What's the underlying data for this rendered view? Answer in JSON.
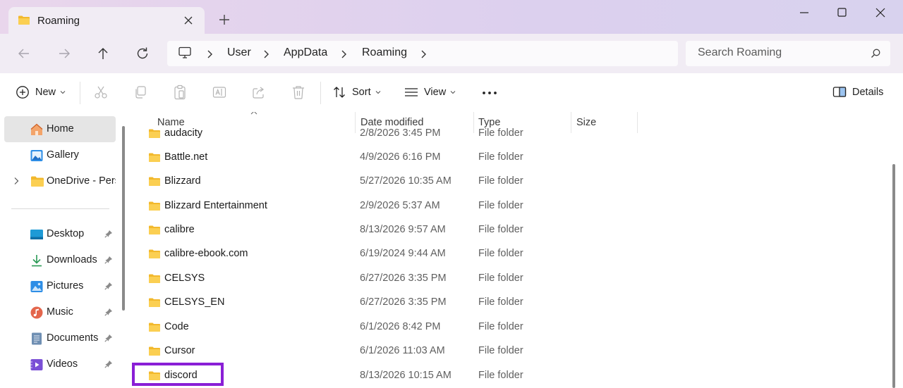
{
  "window": {
    "tab_title": "Roaming"
  },
  "address": {
    "crumbs": [
      "User",
      "AppData",
      "Roaming"
    ],
    "search_placeholder": "Search Roaming"
  },
  "toolbar": {
    "new_label": "New",
    "sort_label": "Sort",
    "view_label": "View",
    "details_label": "Details"
  },
  "sidebar": {
    "items": [
      {
        "label": "Home",
        "icon": "home-icon"
      },
      {
        "label": "Gallery",
        "icon": "gallery-icon"
      },
      {
        "label": "OneDrive - Personal",
        "icon": "folder-icon"
      },
      {
        "label": "Desktop",
        "icon": "desktop-icon"
      },
      {
        "label": "Downloads",
        "icon": "downloads-icon"
      },
      {
        "label": "Pictures",
        "icon": "pictures-icon"
      },
      {
        "label": "Music",
        "icon": "music-icon"
      },
      {
        "label": "Documents",
        "icon": "documents-icon"
      },
      {
        "label": "Videos",
        "icon": "videos-icon"
      }
    ]
  },
  "columns": {
    "name": "Name",
    "date": "Date modified",
    "type": "Type",
    "size": "Size"
  },
  "files": [
    {
      "name": "audacity",
      "date": "2/8/2026 3:45 PM",
      "type": "File folder"
    },
    {
      "name": "Battle.net",
      "date": "4/9/2026 6:16 PM",
      "type": "File folder"
    },
    {
      "name": "Blizzard",
      "date": "5/27/2026 10:35 AM",
      "type": "File folder"
    },
    {
      "name": "Blizzard Entertainment",
      "date": "2/9/2026 5:37 AM",
      "type": "File folder"
    },
    {
      "name": "calibre",
      "date": "8/13/2026 9:57 AM",
      "type": "File folder"
    },
    {
      "name": "calibre-ebook.com",
      "date": "6/19/2024 9:44 AM",
      "type": "File folder"
    },
    {
      "name": "CELSYS",
      "date": "6/27/2026 3:35 PM",
      "type": "File folder"
    },
    {
      "name": "CELSYS_EN",
      "date": "6/27/2026 3:35 PM",
      "type": "File folder"
    },
    {
      "name": "Code",
      "date": "6/1/2026 8:42 PM",
      "type": "File folder"
    },
    {
      "name": "Cursor",
      "date": "6/1/2026 11:03 AM",
      "type": "File folder"
    },
    {
      "name": "discord",
      "date": "8/13/2026 10:15 AM",
      "type": "File folder"
    }
  ],
  "colors": {
    "highlight": "#8a1fd6",
    "folder": "#f5c342"
  }
}
